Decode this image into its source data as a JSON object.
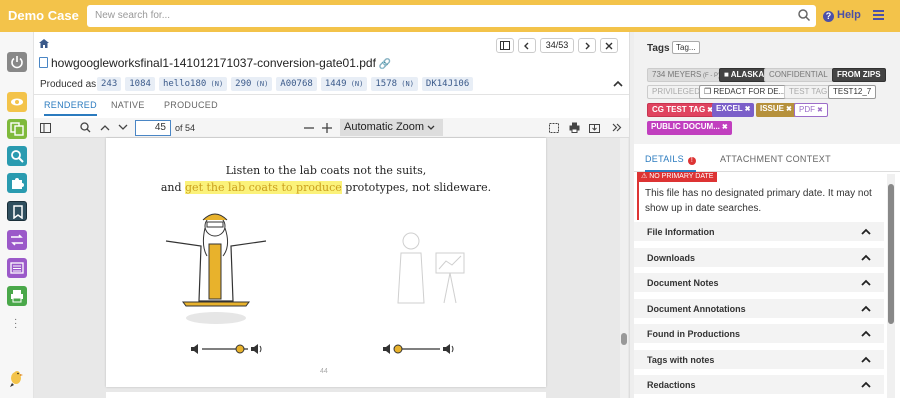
{
  "topbar": {
    "brand": "Demo Case",
    "search_placeholder": "New search for...",
    "help_label": "Help"
  },
  "document": {
    "title": "howgoogleworksfinal1-141012171037-conversion-gate01.pdf",
    "pager_text": "34/53",
    "produced_label": "Produced as:",
    "produced_tags": [
      {
        "text": "243",
        "suffix": ""
      },
      {
        "text": "1084",
        "suffix": ""
      },
      {
        "text": "hello180",
        "suffix": "(N)"
      },
      {
        "text": "290",
        "suffix": "(N)"
      },
      {
        "text": "A00768",
        "suffix": ""
      },
      {
        "text": "1449",
        "suffix": "(N)"
      },
      {
        "text": "1578",
        "suffix": "(N)"
      },
      {
        "text": "DK14J106",
        "suffix": ""
      }
    ],
    "tabs": [
      "RENDERED",
      "NATIVE",
      "PRODUCED"
    ],
    "active_tab": "RENDERED"
  },
  "pdf_viewer": {
    "page_input": "45",
    "of_pages": "of 54",
    "zoom": "Automatic Zoom",
    "line1": "Listen to the lab coats not the suits,",
    "line2_pre": "and ",
    "line2_hl": "get the lab coats to produce",
    "line2_post": " prototypes, not slideware.",
    "page_number": "44"
  },
  "tags_panel": {
    "title": "Tags",
    "add_button": "Tag...",
    "tags": [
      {
        "label": "734 MEYERS",
        "sub": "(F - P)",
        "style": "gray"
      },
      {
        "label": "ALASKA",
        "style": "dark"
      },
      {
        "label": "CONFIDENTIAL",
        "style": "gray"
      },
      {
        "label": "FROM ZIPS",
        "style": "dark"
      },
      {
        "label": "PRIVILEGED",
        "style": "light"
      },
      {
        "label": "REDACT FOR DE...",
        "style": "white"
      },
      {
        "label": "TEST TAG",
        "style": "light"
      },
      {
        "label": "TEST12_7",
        "style": "white"
      },
      {
        "label": "CG TEST TAG",
        "style": "red"
      },
      {
        "label": "EXCEL",
        "style": "purple"
      },
      {
        "label": "ISSUE",
        "style": "olive"
      },
      {
        "label": "PDF",
        "style": "outline"
      },
      {
        "label": "PUBLIC DOCUM...",
        "style": "magenta"
      }
    ]
  },
  "details": {
    "tabs": [
      "DETAILS",
      "ATTACHMENT CONTEXT"
    ],
    "badge": "NO PRIMARY DATE",
    "warning": "This file has no designated primary date. It may not show up in date searches.",
    "sections": [
      "File Information",
      "Downloads",
      "Document Notes",
      "Document Annotations",
      "Found in Productions",
      "Tags with notes",
      "Redactions"
    ]
  },
  "colors": {
    "topbar": "#f3c34a",
    "accent": "#2b7bbf",
    "alert": "#d33"
  }
}
